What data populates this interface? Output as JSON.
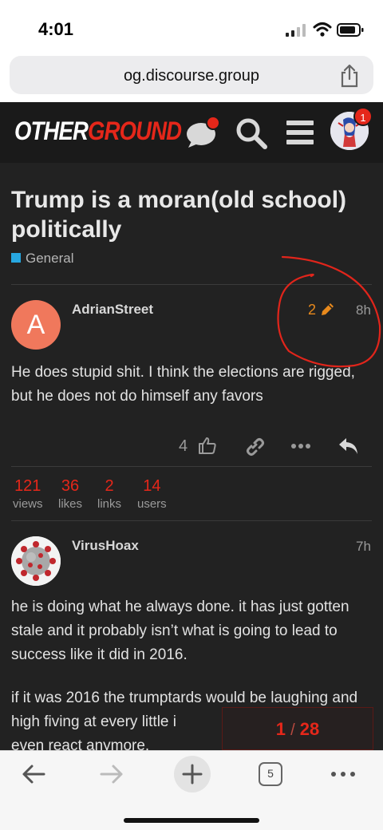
{
  "status_bar": {
    "time": "4:01"
  },
  "browser": {
    "url": "og.discourse.group",
    "tab_count": "5"
  },
  "site": {
    "logo_part1": "OTHER",
    "logo_part2": "GROUND",
    "notification_count": "1"
  },
  "topic": {
    "title": "Trump is a moran(old school) politically",
    "category": "General",
    "category_color": "#27a7e0"
  },
  "posts": [
    {
      "avatar_letter": "A",
      "avatar_color": "#f0785c",
      "username": "AdrianStreet",
      "edit_count": "2",
      "time": "8h",
      "paragraphs": [
        "He does stupid shit. I think the elections are rigged, but he does not do himself any favors"
      ],
      "like_count": "4"
    },
    {
      "username": "VirusHoax",
      "time": "7h",
      "paragraphs": [
        "he is doing what he always done. it has just gotten stale and it probably isn’t what is going to lead to success like it did in 2016.",
        "if it was 2016 the trumptards would be laughing and high fiving at every little i",
        "even react anymore."
      ]
    }
  ],
  "topic_stats": [
    {
      "value": "121",
      "label": "views"
    },
    {
      "value": "36",
      "label": "likes"
    },
    {
      "value": "2",
      "label": "links"
    },
    {
      "value": "14",
      "label": "users"
    }
  ],
  "progress": {
    "current": "1",
    "separator": "/",
    "total": "28"
  },
  "colors": {
    "accent": "#e5271a",
    "header_bg": "#1a1a1a",
    "content_bg": "#222222",
    "edit_orange": "#e8891c"
  }
}
